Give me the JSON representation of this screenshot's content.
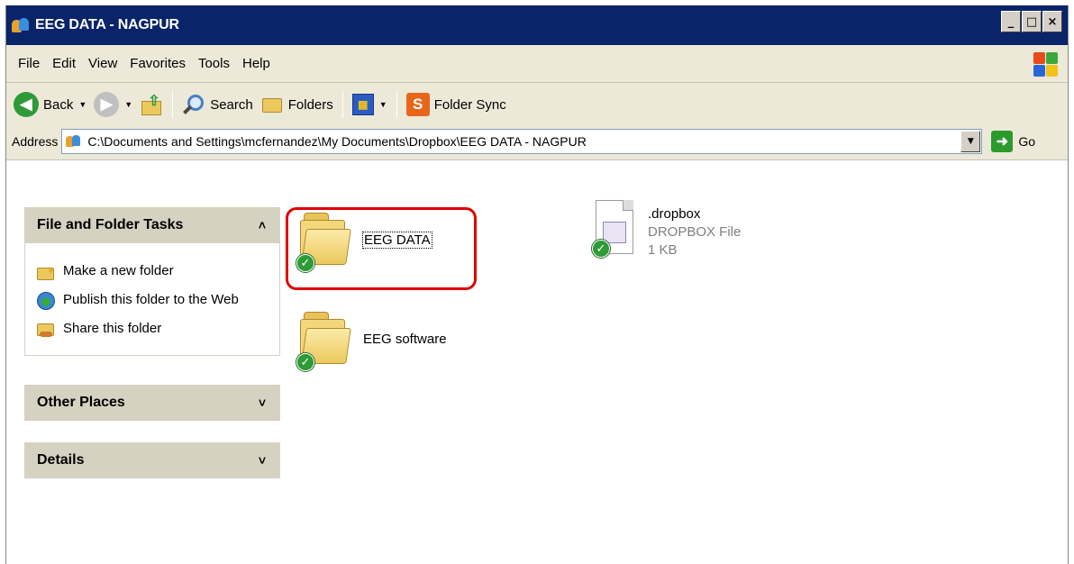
{
  "window": {
    "title": "EEG DATA - NAGPUR",
    "minimize": "_",
    "maximize": "□",
    "close": "×"
  },
  "menu": [
    "File",
    "Edit",
    "View",
    "Favorites",
    "Tools",
    "Help"
  ],
  "toolbar": {
    "back_label": "Back",
    "search_label": "Search",
    "folders_label": "Folders",
    "folder_sync_label": "Folder Sync"
  },
  "address": {
    "label": "Address",
    "path": "C:\\Documents and Settings\\mcfernandez\\My Documents\\Dropbox\\EEG DATA - NAGPUR",
    "go_label": "Go"
  },
  "taskpane": {
    "file_folder_tasks": {
      "title": "File and Folder Tasks",
      "items": [
        "Make a new folder",
        "Publish this folder to the Web",
        "Share this folder"
      ]
    },
    "other_places": {
      "title": "Other Places"
    },
    "details": {
      "title": "Details"
    }
  },
  "items": [
    {
      "name": "EEG DATA",
      "type": "folder",
      "synced": true,
      "selected": true
    },
    {
      "name": "EEG software",
      "type": "folder",
      "synced": true
    },
    {
      "name": ".dropbox",
      "type": "file",
      "file_type": "DROPBOX File",
      "size": "1 KB",
      "synced": true
    }
  ],
  "colors": {
    "titlebar": "#0a246a",
    "highlight": "#e00000",
    "sync_check": "#2f9a38"
  }
}
